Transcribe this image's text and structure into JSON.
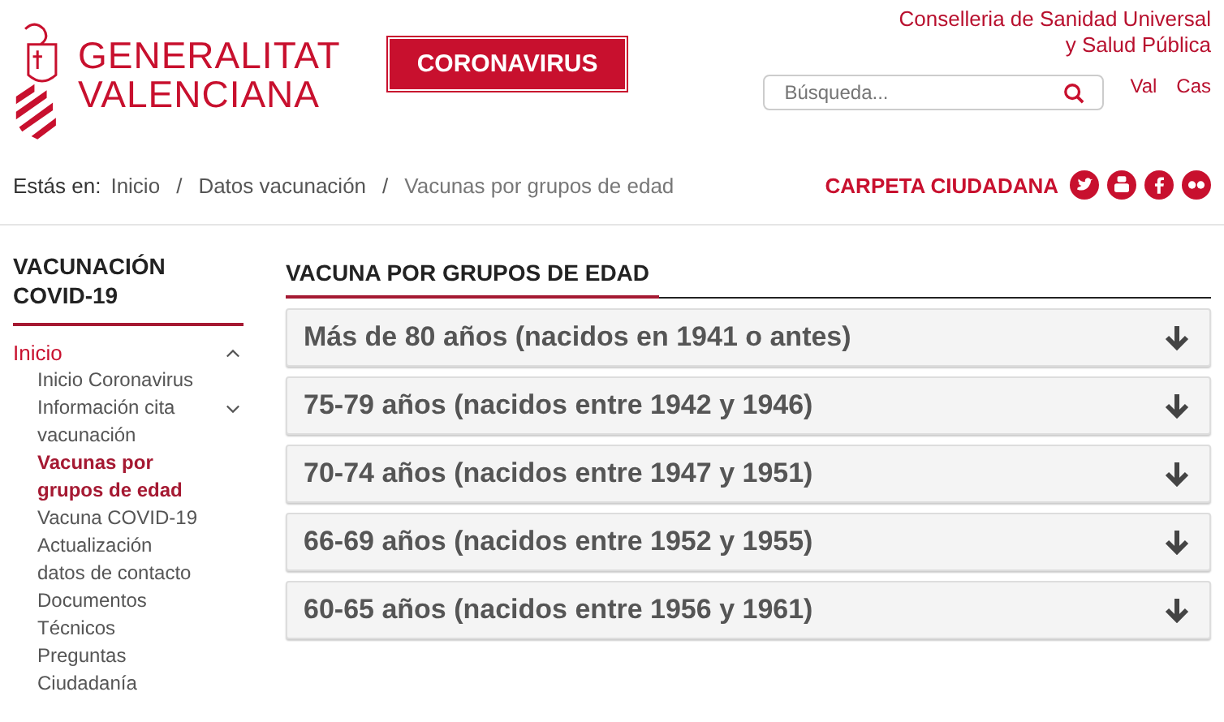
{
  "header": {
    "logo_lines": [
      "GENERALITAT",
      "VALENCIANA"
    ],
    "badge": "CORONAVIRUS",
    "department_lines": [
      "Conselleria de Sanidad Universal",
      "y Salud Pública"
    ],
    "search": {
      "placeholder": "Búsqueda..."
    },
    "languages": [
      "Val",
      "Cas"
    ]
  },
  "breadcrumb": {
    "label": "Estás en:",
    "items": [
      "Inicio",
      "Datos vacunación",
      "Vacunas por grupos de edad"
    ],
    "separator": "/"
  },
  "citizen_link": "CARPETA CIUDADANA",
  "sidebar": {
    "title": "VACUNACIÓN COVID-19",
    "items": [
      {
        "label": "Inicio",
        "selected": false,
        "expanded": true,
        "children": [
          {
            "label": "Inicio Coronavirus",
            "selected": false
          },
          {
            "label": "Información cita vacunación",
            "selected": false,
            "expanded": false
          },
          {
            "label": "Vacunas por grupos de edad",
            "selected": true
          },
          {
            "label": "Vacuna COVID-19",
            "selected": false
          },
          {
            "label": "Actualización datos de contacto",
            "selected": false
          },
          {
            "label": "Documentos Técnicos",
            "selected": false
          },
          {
            "label": "Preguntas Ciudadanía",
            "selected": false
          }
        ]
      }
    ]
  },
  "section": {
    "title": "VACUNA POR GRUPOS DE EDAD",
    "items": [
      {
        "label": "Más de 80 años (nacidos en 1941 o antes)",
        "expanded": false
      },
      {
        "label": "75-79 años (nacidos entre 1942 y 1946)",
        "expanded": false
      },
      {
        "label": "70-74 años (nacidos entre 1947 y 1951)",
        "expanded": false
      },
      {
        "label": "66-69 años (nacidos entre 1952 y 1955)",
        "expanded": false
      },
      {
        "label": "60-65 años (nacidos entre 1956 y 1961)",
        "expanded": false
      }
    ]
  }
}
